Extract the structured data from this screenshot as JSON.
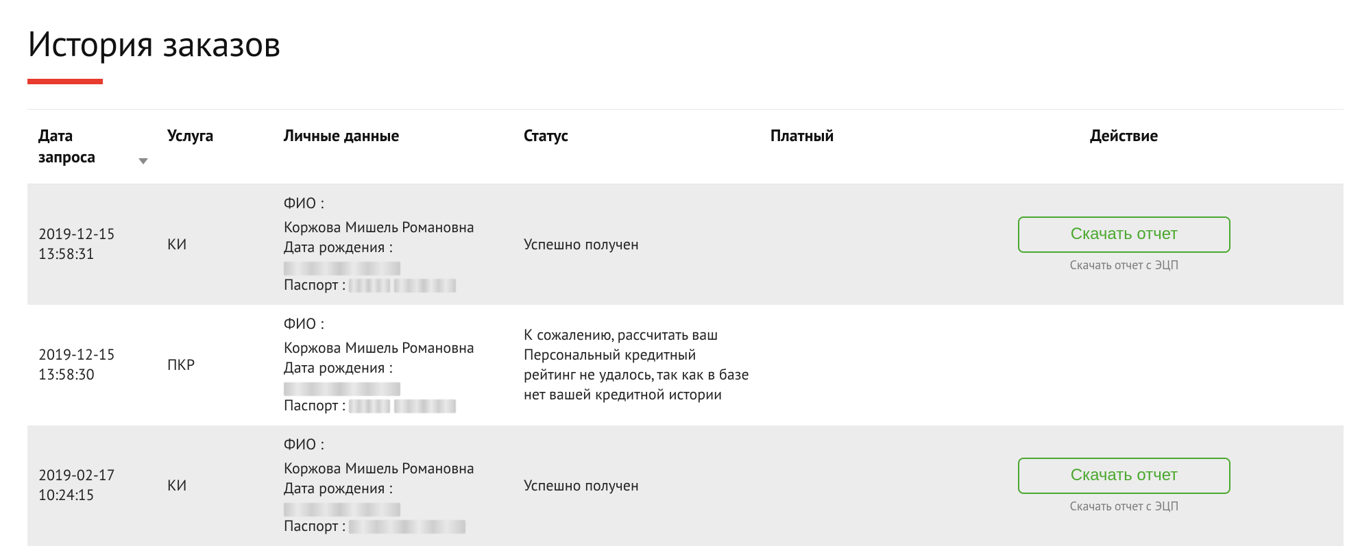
{
  "page": {
    "title": "История заказов"
  },
  "table": {
    "headers": {
      "date": "Дата запроса",
      "service": "Услуга",
      "personal": "Личные данные",
      "status": "Статус",
      "paid": "Платный",
      "action": "Действие"
    },
    "personal_labels": {
      "fio": "ФИО :",
      "dob": "Дата рождения :",
      "passport": "Паспорт :"
    },
    "action_labels": {
      "download": "Скачать отчет",
      "download_signed": "Скачать отчет с ЭЦП"
    },
    "rows": [
      {
        "date": "2019-12-15 13:58:31",
        "service": "КИ",
        "fio": "Коржова Мишель Романовна",
        "status": "Успешно получен",
        "paid": "",
        "has_action": true
      },
      {
        "date": "2019-12-15 13:58:30",
        "service": "ПКР",
        "fio": "Коржова Мишель Романовна",
        "status": "К сожалению, рассчитать ваш Персональный кредитный рейтинг не удалось, так как в базе нет вашей кредитной истории",
        "paid": "",
        "has_action": false
      },
      {
        "date": "2019-02-17 10:24:15",
        "service": "КИ",
        "fio": "Коржова Мишель Романовна",
        "status": "Успешно получен",
        "paid": "",
        "has_action": true
      }
    ]
  }
}
